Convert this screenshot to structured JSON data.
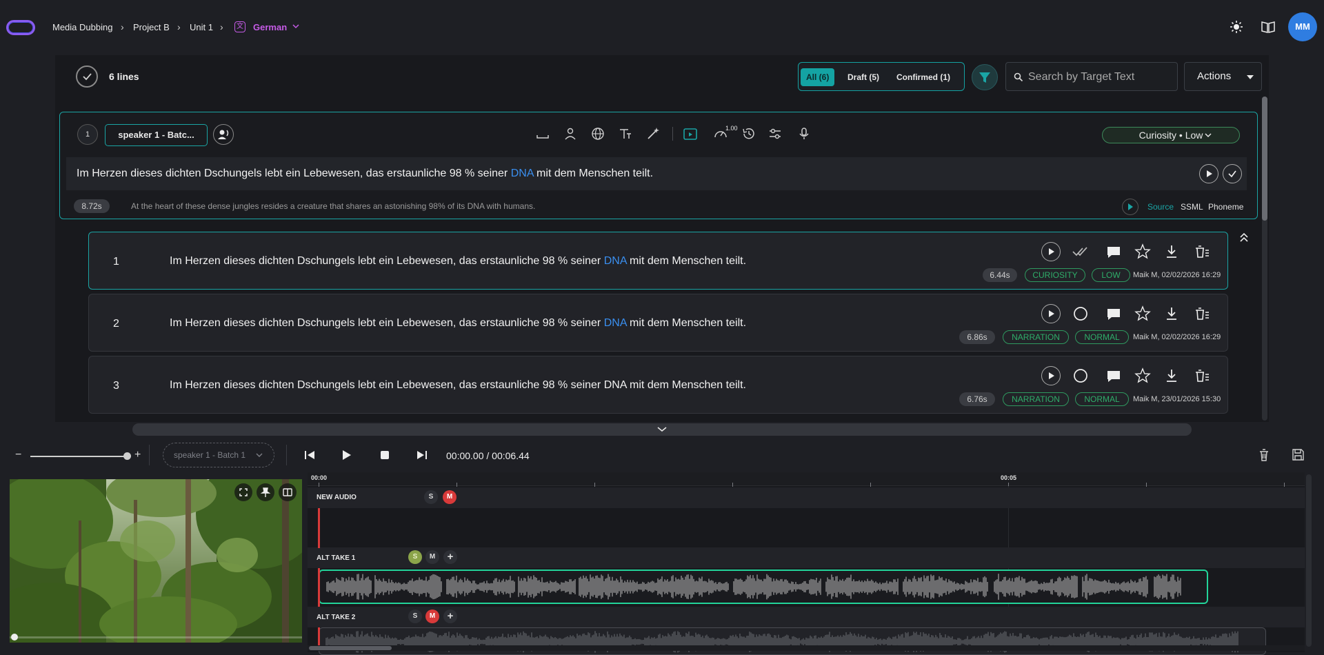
{
  "breadcrumb": {
    "items": [
      "Media Dubbing",
      "Project B",
      "Unit 1"
    ],
    "language": "German"
  },
  "user": {
    "initials": "MM"
  },
  "header": {
    "lines_label": "6 lines",
    "filters": [
      {
        "label": "All (6)",
        "active": true
      },
      {
        "label": "Draft (5)",
        "active": false
      },
      {
        "label": "Confirmed (1)",
        "active": false
      }
    ],
    "search_placeholder": "Search by Target Text",
    "actions_label": "Actions"
  },
  "editor": {
    "number": "1",
    "speaker": "speaker 1 - Batc...",
    "speed_value": "1.00",
    "emotion": "Curiosity • Low",
    "text_before": "Im Herzen dieses dichten Dschungels lebt ein Lebewesen, das erstaunliche 98 % seiner ",
    "text_highlight": "DNA",
    "text_after": " mit dem Menschen teilt.",
    "duration": "8.72s",
    "source_text": "At the heart of these dense jungles resides a creature that shares an astonishing 98% of its DNA with humans.",
    "modes": [
      "Source",
      "SSML",
      "Phoneme"
    ]
  },
  "takes": [
    {
      "number": "1",
      "text_before": "Im Herzen dieses dichten Dschungels lebt ein Lebewesen, das erstaunliche 98 % seiner ",
      "text_highlight": "DNA",
      "text_after": " mit dem Menschen teilt.",
      "duration": "6.44s",
      "emotion_tag": "CURIOSITY",
      "intensity_tag": "LOW",
      "meta": "Maik M, 02/02/2026 16:29",
      "confirmed": true
    },
    {
      "number": "2",
      "text_before": "Im Herzen dieses dichten Dschungels lebt ein Lebewesen, das erstaunliche 98 % seiner ",
      "text_highlight": "DNA",
      "text_after": " mit dem Menschen teilt.",
      "duration": "6.86s",
      "emotion_tag": "NARRATION",
      "intensity_tag": "NORMAL",
      "meta": "Maik M, 02/02/2026 16:29",
      "confirmed": false
    },
    {
      "number": "3",
      "text_before": "Im Herzen dieses dichten Dschungels lebt ein Lebewesen, das erstaunliche 98 % seiner DNA mit dem Menschen teilt.",
      "text_highlight": "",
      "text_after": "",
      "duration": "6.76s",
      "emotion_tag": "NARRATION",
      "intensity_tag": "NORMAL",
      "meta": "Maik M, 23/01/2026 15:30",
      "confirmed": false
    }
  ],
  "player": {
    "speaker_select": "speaker 1 - Batch 1",
    "timecode": "00:00.00 / 00:06.44"
  },
  "timeline": {
    "ruler_labels": [
      "00:00",
      "00:05"
    ],
    "tracks": [
      {
        "name": "NEW AUDIO",
        "solo": "S",
        "mute": "M"
      },
      {
        "name": "ALT TAKE 1",
        "solo": "S",
        "mute": "M"
      },
      {
        "name": "ALT TAKE 2",
        "solo": "S",
        "mute": "M"
      }
    ]
  },
  "colors": {
    "accent": "#1aa5a5",
    "language": "#c65be6",
    "highlight": "#3a8ff0",
    "tag_green": "#2fae6a",
    "clip_border": "#22d49a",
    "mute_red": "#d83a3a"
  }
}
